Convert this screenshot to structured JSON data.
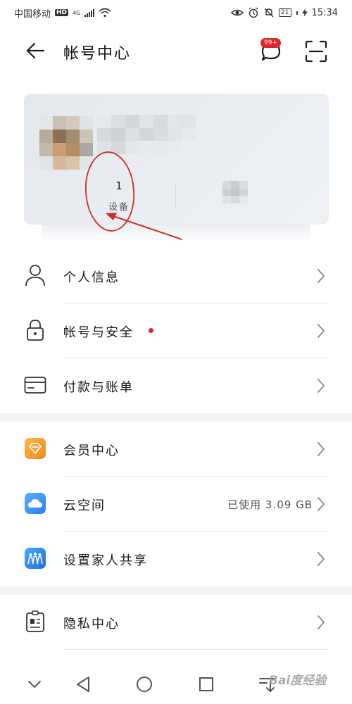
{
  "status_bar": {
    "carrier": "中国移动",
    "hd": "HD",
    "network": "4G",
    "battery": "21",
    "time": "15:34"
  },
  "header": {
    "title": "帐号中心",
    "message_badge": "99+"
  },
  "profile": {
    "device_count": "1",
    "device_label": "设备"
  },
  "menu": {
    "personal_info": "个人信息",
    "account_security": "帐号与安全",
    "payment_billing": "付款与账单",
    "member_center": "会员中心",
    "cloud_space": "云空间",
    "cloud_usage": "已使用 3.09 GB",
    "family_sharing": "设置家人共享",
    "privacy_center": "隐私中心"
  },
  "icons": {
    "back": "back-arrow-icon",
    "messages": "chat-bubble-icon",
    "scan": "scan-icon",
    "personal_info": "person-icon",
    "account_security": "lock-icon",
    "payment_billing": "credit-card-icon",
    "member_center": "diamond-icon",
    "cloud_space": "cloud-icon",
    "family_sharing": "family-icon",
    "privacy_center": "id-card-icon"
  },
  "colors": {
    "accent_red": "#e0242a",
    "member_icon": "#f5a023",
    "cloud_icon": "#3b92f5",
    "annotation_red": "#d42a2a"
  },
  "watermark": "Bai度经验"
}
